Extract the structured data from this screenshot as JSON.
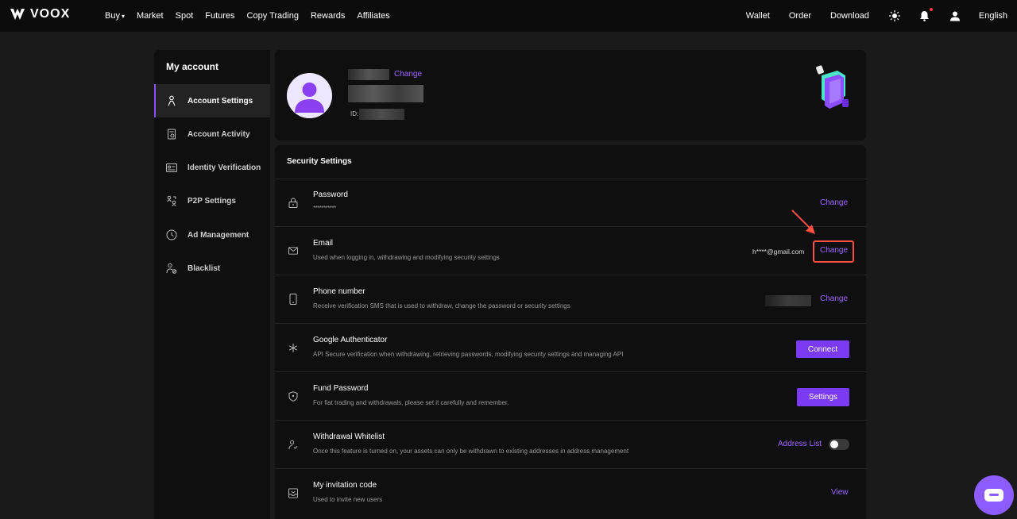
{
  "nav": {
    "logo": "VOOX",
    "left_items": [
      "Buy",
      "Market",
      "Spot",
      "Futures",
      "Copy Trading",
      "Rewards",
      "Affiliates"
    ],
    "right_items": [
      "Wallet",
      "Order",
      "Download"
    ],
    "language": "English",
    "icons": [
      "sun-icon",
      "bell-icon",
      "user-icon"
    ]
  },
  "sidebar": {
    "title": "My account",
    "items": [
      {
        "label": "Account Settings",
        "icon": "person-icon",
        "active": true
      },
      {
        "label": "Account Activity",
        "icon": "activity-log-icon",
        "active": false
      },
      {
        "label": "Identity Verification",
        "icon": "id-card-icon",
        "active": false
      },
      {
        "label": "P2P Settings",
        "icon": "p2p-users-icon",
        "active": false
      },
      {
        "label": "Ad Management",
        "icon": "clock-icon",
        "active": false
      },
      {
        "label": "Blacklist",
        "icon": "user-block-icon",
        "active": false
      }
    ]
  },
  "profile": {
    "name_change": "Change",
    "id_label": "ID:"
  },
  "security": {
    "title": "Security Settings",
    "rows": [
      {
        "title": "Password",
        "desc": "***********",
        "action": "Change"
      },
      {
        "title": "Email",
        "desc": "Used when logging in, withdrawing and modifying security settings",
        "value": "h****@gmail.com",
        "action": "Change"
      },
      {
        "title": "Phone number",
        "desc": "Receive verification SMS that is used to withdraw, change the password or security settings",
        "action": "Change"
      },
      {
        "title": "Google Authenticator",
        "desc": "API Secure verification when withdrawing, retrieving passwords, modifying security settings and managing API",
        "action": "Connect"
      },
      {
        "title": "Fund Password",
        "desc": "For fiat trading and withdrawals, please set it carefully and remember.",
        "action": "Settings"
      },
      {
        "title": "Withdrawal Whitelist",
        "desc": "Once this feature is turned on, your assets can only be withdrawn to existing addresses in address management",
        "action": "Address List",
        "toggle": false
      },
      {
        "title": "My invitation code",
        "desc": "Used to invite new users",
        "action": "View"
      }
    ]
  },
  "colors": {
    "accent": "#7b3bf2",
    "link": "#a066ff",
    "highlight": "#ff4f42"
  }
}
